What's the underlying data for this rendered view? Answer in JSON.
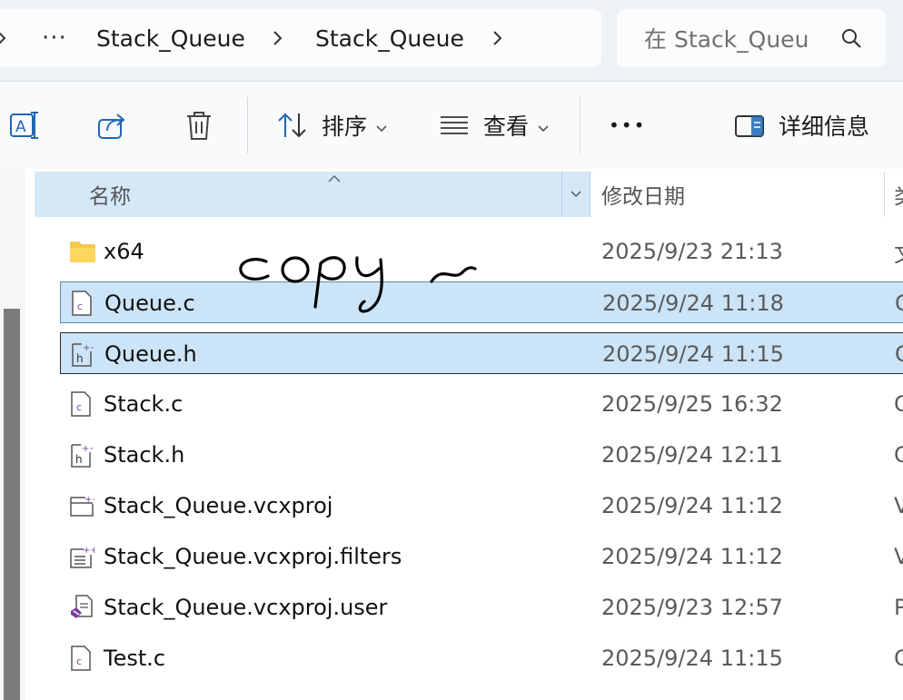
{
  "address": {
    "more": "···",
    "crumbs": [
      "Stack_Queue",
      "Stack_Queue"
    ]
  },
  "search": {
    "placeholder": "在 Stack_Queu"
  },
  "toolbar": {
    "sort_label": "排序",
    "view_label": "查看",
    "more": "•••",
    "details_label": "详细信息"
  },
  "columns": {
    "name": "名称",
    "modified": "修改日期",
    "type": "类"
  },
  "files": [
    {
      "name": "x64",
      "modified": "2025/9/23 21:13",
      "type": "文",
      "icon": "folder-icon"
    },
    {
      "name": "Queue.c",
      "modified": "2025/9/24 11:18",
      "type": "C",
      "icon": "c-source-icon"
    },
    {
      "name": "Queue.h",
      "modified": "2025/9/24 11:15",
      "type": "C",
      "icon": "header-file-icon"
    },
    {
      "name": "Stack.c",
      "modified": "2025/9/25 16:32",
      "type": "C",
      "icon": "c-source-icon"
    },
    {
      "name": "Stack.h",
      "modified": "2025/9/24 12:11",
      "type": "C",
      "icon": "header-file-icon"
    },
    {
      "name": "Stack_Queue.vcxproj",
      "modified": "2025/9/24 11:12",
      "type": "V",
      "icon": "vcxproj-icon"
    },
    {
      "name": "Stack_Queue.vcxproj.filters",
      "modified": "2025/9/24 11:12",
      "type": "V",
      "icon": "filters-file-icon"
    },
    {
      "name": "Stack_Queue.vcxproj.user",
      "modified": "2025/9/23 12:57",
      "type": "P",
      "icon": "visual-studio-user-icon"
    },
    {
      "name": "Test.c",
      "modified": "2025/9/24 11:15",
      "type": "C",
      "icon": "c-source-icon"
    }
  ],
  "annotation": "copy ~",
  "colors": {
    "selection": "#cce4f7",
    "header": "#d5e8f8",
    "accent": "#1f66b3"
  }
}
